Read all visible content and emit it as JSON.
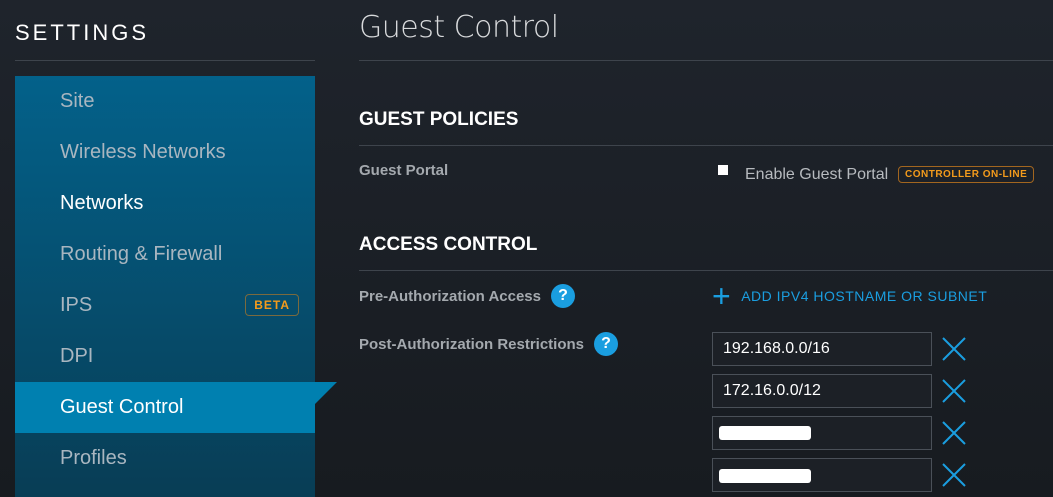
{
  "sidebar": {
    "title": "SETTINGS",
    "items": [
      {
        "label": "Site"
      },
      {
        "label": "Wireless Networks"
      },
      {
        "label": "Networks"
      },
      {
        "label": "Routing & Firewall"
      },
      {
        "label": "IPS",
        "badge": "BETA"
      },
      {
        "label": "DPI"
      },
      {
        "label": "Guest Control",
        "active": true
      },
      {
        "label": "Profiles"
      }
    ]
  },
  "main": {
    "title": "Guest Control",
    "guest_policies": {
      "heading": "GUEST POLICIES",
      "guest_portal_label": "Guest Portal",
      "enable_label": "Enable Guest Portal",
      "enabled": false,
      "badge": "CONTROLLER ON-LINE"
    },
    "access_control": {
      "heading": "ACCESS CONTROL",
      "pre_auth_label": "Pre-Authorization Access",
      "add_label": "ADD IPV4 HOSTNAME OR SUBNET",
      "post_auth_label": "Post-Authorization Restrictions",
      "help": "?",
      "restrictions": [
        "192.168.0.0/16",
        "172.16.0.0/12",
        "",
        ""
      ]
    }
  },
  "colors": {
    "accent": "#1a9ee0",
    "active": "#0080b0",
    "badge": "#f39b1c"
  }
}
